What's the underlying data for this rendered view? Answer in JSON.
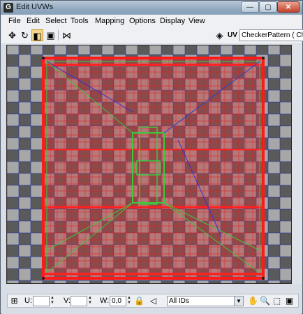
{
  "window": {
    "title": "Edit UVWs",
    "minimize": "—",
    "maximize": "▢",
    "close": "✕"
  },
  "menu": [
    "File",
    "Edit",
    "Select",
    "Tools",
    "Mapping",
    "Options",
    "Display",
    "View"
  ],
  "toolbar": {
    "uv_label": "UV",
    "texture_select": "CheckerPattern  ( Che"
  },
  "status": {
    "u_label": "U:",
    "v_label": "V:",
    "w_label": "W:",
    "u_value": "",
    "v_value": "",
    "w_value": "0,0",
    "id_filter": "All IDs"
  },
  "icons": [
    "move-icon",
    "rotate-icon",
    "scale-icon",
    "freeform-icon",
    "mirror-icon",
    "texture-icon",
    "pan-hand-icon",
    "zoom-icon",
    "zoom-region-icon",
    "zoom-extents-icon",
    "lock-icon",
    "paint-select-icon"
  ]
}
